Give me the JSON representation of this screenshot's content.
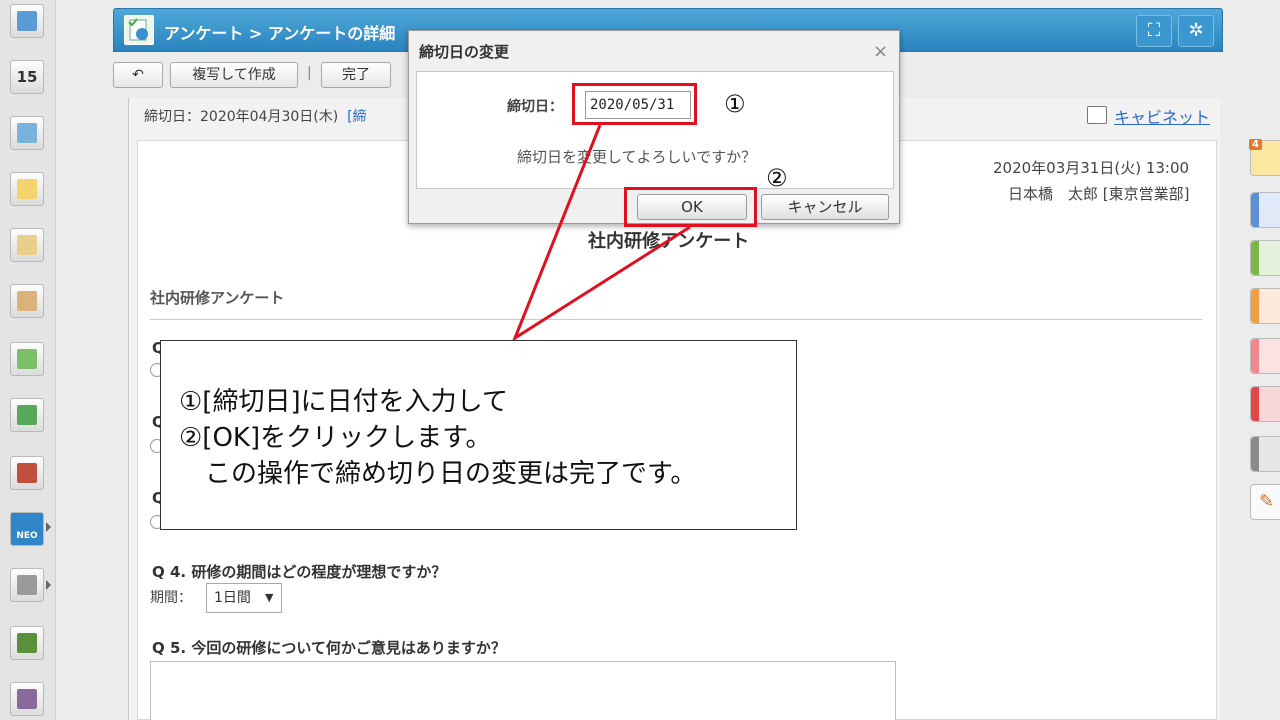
{
  "sidebar": {
    "apps": [
      {
        "name": "portal-app-icon",
        "color": "#5b9bd5"
      },
      {
        "name": "calendar-app-icon",
        "text": "15",
        "color": "#3f7fc0"
      },
      {
        "name": "facility-app-icon",
        "color": "#7ab2dc"
      },
      {
        "name": "memo-app-icon",
        "color": "#f3d36b"
      },
      {
        "name": "board-app-icon",
        "color": "#e8d08a"
      },
      {
        "name": "report-app-icon",
        "color": "#d9b27c"
      },
      {
        "name": "survey-app-icon",
        "color": "#7bbf6a"
      },
      {
        "name": "workflow-app-icon",
        "color": "#58a85a"
      },
      {
        "name": "cabinet-app-icon",
        "color": "#c0503b"
      },
      {
        "name": "neo-app-icon",
        "text": "NEO",
        "color": "#2f86c8"
      },
      {
        "name": "folder-app-icon",
        "color": "#9a9a9a"
      },
      {
        "name": "timecard-app-icon",
        "color": "#5a8f3c"
      },
      {
        "name": "misc-app-icon",
        "color": "#8a6a9a"
      }
    ]
  },
  "header": {
    "breadcrumb": "アンケート > アンケートの詳細"
  },
  "toolbar": {
    "duplicate_label": "複写して作成",
    "separator": "|",
    "done_label": "完了"
  },
  "infobar": {
    "deadline_text": "締切日：2020年04月30日(木)",
    "deadline_change_link": "[締",
    "cabinet_link": "キャビネット"
  },
  "document": {
    "date": "2020年03月31日(火) 13:00",
    "author": "日本橋　太郎 [東京営業部]",
    "title": "社内研修アンケート",
    "subtitle": "社内研修アンケート",
    "q_prefix_1": "Q",
    "q_prefix_2": "Q",
    "q_prefix_3": "Q",
    "q4": "Q 4. 研修の期間はどの程度が理想ですか？",
    "period_label": "期間：",
    "period_value": "1日間",
    "q5": "Q 5. 今回の研修について何かご意見はありますか？"
  },
  "dialog": {
    "title": "締切日の変更",
    "close_glyph": "×",
    "deadline_label": "締切日：",
    "deadline_value": "2020/05/31",
    "message": "締切日を変更してよろしいですか？",
    "ok_label": "OK",
    "cancel_label": "キャンセル"
  },
  "annotations": {
    "marker_1": "①",
    "marker_2": "②",
    "callout_lines": [
      "①[締切日]に日付を入力して",
      "②[OK]をクリックします。",
      "　この操作で締め切り日の変更は完了です。"
    ],
    "highlight_color": "#e01020"
  },
  "right_panel": {
    "badge": "4",
    "tabs": [
      "#5b8fd6",
      "#7ab648",
      "#f0a040",
      "#f08890",
      "#e04848",
      "#8a8a8a"
    ]
  }
}
